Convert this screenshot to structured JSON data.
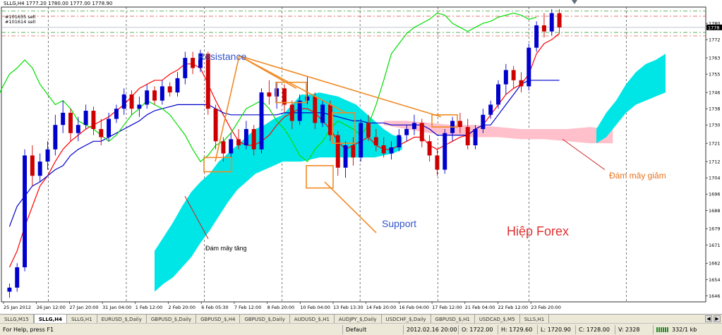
{
  "chart_info": {
    "header": "SLLG,H4  1777.20 1780.00 1777.00 1778.90",
    "level_labels": [
      "#101655 sell",
      "#101614 sell"
    ]
  },
  "price_axis": {
    "ticks": [
      "1780",
      "1772",
      "1763",
      "1755",
      "1746",
      "1738",
      "1730",
      "1721",
      "1712",
      "1704",
      "1696",
      "1688",
      "1679",
      "1671",
      "1662",
      "1654",
      "1646"
    ],
    "current_price": "1778"
  },
  "time_axis": {
    "ticks": [
      "25 Jan 2012",
      "26 Jan 12:00",
      "27 Jan 20:00",
      "31 Jan 04:00",
      "1 Feb 12:00",
      "2 Feb 20:00",
      "6 Feb 05:30",
      "7 Feb 12:00",
      "8 Feb 20:00",
      "10 Feb 04:00",
      "13 Feb 13:30",
      "14 Feb 20:00",
      "16 Feb 04:00",
      "17 Feb 12:00",
      "21 Feb 04:00",
      "22 Feb 12:00",
      "23 Feb 20:00"
    ]
  },
  "annotations": {
    "resistance": "Resistance",
    "support": "Support",
    "cloud_down": "Đám mây giảm",
    "cloud_up": "Đám mây tăng",
    "watermark": "Hiệp Forex"
  },
  "colors": {
    "candle_up": "#0000cc",
    "candle_down": "#cc0000",
    "tenkan": "#ff0000",
    "kijun": "#0000cc",
    "chikou": "#00dd00",
    "kumo_bull": "#00e6e6",
    "kumo_bear": "#ffc0cb",
    "annotation_box": "#f08a24",
    "resistance_text": "#3355cc",
    "cloud_text": "#e8701c",
    "watermark_text": "#e03030"
  },
  "tabs": [
    {
      "label": "SLLG,M15",
      "active": false
    },
    {
      "label": "SLLG,H4",
      "active": true
    },
    {
      "label": "SLLG,H1",
      "active": false
    },
    {
      "label": "EURUSD_$,Daily",
      "active": false
    },
    {
      "label": "GBPUSD_$,Daily",
      "active": false
    },
    {
      "label": "GBPUSD_$,H4",
      "active": false
    },
    {
      "label": "GBPUSD_$,Daily",
      "active": false
    },
    {
      "label": "AUDUSD_$,H1",
      "active": false
    },
    {
      "label": "AUDJPY_$,Daily",
      "active": false
    },
    {
      "label": "USDCHF_$,Daily",
      "active": false
    },
    {
      "label": "GBPUSD_$,H1",
      "active": false
    },
    {
      "label": "USDCAD_$,M5",
      "active": false
    },
    {
      "label": "SLLS,H1",
      "active": false
    }
  ],
  "status_bar": {
    "help": "For Help, press F1",
    "profile": "Default",
    "datetime": "2012.02.16 20:00",
    "open": "O: 1722.00",
    "high": "H: 1729.60",
    "low": "L: 1720.90",
    "close": "C: 1728.00",
    "volume": "V: 2328",
    "traffic": "332/1 kb"
  },
  "chart_data": {
    "type": "candlestick",
    "symbol": "SLLG",
    "timeframe": "H4",
    "ylim": [
      1643,
      1788
    ],
    "indicator": "Ichimoku Kinko Hyo",
    "sell_levels": [
      1783.5,
      1775.5,
      1773.8,
      1786.0
    ],
    "candles": [
      {
        "o": 1648,
        "h": 1652,
        "l": 1645,
        "c": 1650
      },
      {
        "o": 1650,
        "h": 1662,
        "l": 1648,
        "c": 1660
      },
      {
        "o": 1660,
        "h": 1718,
        "l": 1658,
        "c": 1715
      },
      {
        "o": 1715,
        "h": 1720,
        "l": 1700,
        "c": 1705
      },
      {
        "o": 1705,
        "h": 1716,
        "l": 1702,
        "c": 1712
      },
      {
        "o": 1712,
        "h": 1722,
        "l": 1708,
        "c": 1718
      },
      {
        "o": 1718,
        "h": 1735,
        "l": 1715,
        "c": 1730
      },
      {
        "o": 1730,
        "h": 1742,
        "l": 1726,
        "c": 1736
      },
      {
        "o": 1736,
        "h": 1738,
        "l": 1722,
        "c": 1726
      },
      {
        "o": 1726,
        "h": 1734,
        "l": 1722,
        "c": 1730
      },
      {
        "o": 1730,
        "h": 1740,
        "l": 1728,
        "c": 1737
      },
      {
        "o": 1737,
        "h": 1739,
        "l": 1725,
        "c": 1728
      },
      {
        "o": 1728,
        "h": 1733,
        "l": 1720,
        "c": 1724
      },
      {
        "o": 1724,
        "h": 1736,
        "l": 1722,
        "c": 1733
      },
      {
        "o": 1733,
        "h": 1740,
        "l": 1731,
        "c": 1738
      },
      {
        "o": 1738,
        "h": 1748,
        "l": 1735,
        "c": 1745
      },
      {
        "o": 1745,
        "h": 1747,
        "l": 1735,
        "c": 1738
      },
      {
        "o": 1738,
        "h": 1744,
        "l": 1734,
        "c": 1740
      },
      {
        "o": 1740,
        "h": 1750,
        "l": 1738,
        "c": 1747
      },
      {
        "o": 1747,
        "h": 1749,
        "l": 1740,
        "c": 1742
      },
      {
        "o": 1742,
        "h": 1752,
        "l": 1740,
        "c": 1749
      },
      {
        "o": 1749,
        "h": 1751,
        "l": 1744,
        "c": 1746
      },
      {
        "o": 1746,
        "h": 1756,
        "l": 1744,
        "c": 1753
      },
      {
        "o": 1753,
        "h": 1766,
        "l": 1750,
        "c": 1763
      },
      {
        "o": 1763,
        "h": 1766,
        "l": 1755,
        "c": 1758
      },
      {
        "o": 1758,
        "h": 1767,
        "l": 1756,
        "c": 1765
      },
      {
        "o": 1765,
        "h": 1766,
        "l": 1735,
        "c": 1738
      },
      {
        "o": 1738,
        "h": 1740,
        "l": 1718,
        "c": 1722
      },
      {
        "o": 1722,
        "h": 1724,
        "l": 1712,
        "c": 1716
      },
      {
        "o": 1716,
        "h": 1726,
        "l": 1714,
        "c": 1723
      },
      {
        "o": 1723,
        "h": 1728,
        "l": 1718,
        "c": 1720
      },
      {
        "o": 1720,
        "h": 1732,
        "l": 1718,
        "c": 1728
      },
      {
        "o": 1728,
        "h": 1730,
        "l": 1715,
        "c": 1718
      },
      {
        "o": 1718,
        "h": 1748,
        "l": 1716,
        "c": 1746
      },
      {
        "o": 1746,
        "h": 1752,
        "l": 1740,
        "c": 1744
      },
      {
        "o": 1744,
        "h": 1751,
        "l": 1738,
        "c": 1748
      },
      {
        "o": 1748,
        "h": 1750,
        "l": 1736,
        "c": 1740
      },
      {
        "o": 1740,
        "h": 1742,
        "l": 1728,
        "c": 1732
      },
      {
        "o": 1732,
        "h": 1745,
        "l": 1730,
        "c": 1742
      },
      {
        "o": 1742,
        "h": 1754,
        "l": 1740,
        "c": 1744
      },
      {
        "o": 1744,
        "h": 1746,
        "l": 1728,
        "c": 1731
      },
      {
        "o": 1731,
        "h": 1742,
        "l": 1729,
        "c": 1740
      },
      {
        "o": 1740,
        "h": 1742,
        "l": 1722,
        "c": 1725
      },
      {
        "o": 1725,
        "h": 1727,
        "l": 1705,
        "c": 1709
      },
      {
        "o": 1709,
        "h": 1722,
        "l": 1704,
        "c": 1720
      },
      {
        "o": 1720,
        "h": 1724,
        "l": 1710,
        "c": 1714
      },
      {
        "o": 1714,
        "h": 1733,
        "l": 1712,
        "c": 1731
      },
      {
        "o": 1731,
        "h": 1735,
        "l": 1722,
        "c": 1724
      },
      {
        "o": 1724,
        "h": 1728,
        "l": 1717,
        "c": 1720
      },
      {
        "o": 1720,
        "h": 1724,
        "l": 1714,
        "c": 1716
      },
      {
        "o": 1716,
        "h": 1722,
        "l": 1713,
        "c": 1719
      },
      {
        "o": 1719,
        "h": 1728,
        "l": 1717,
        "c": 1725
      },
      {
        "o": 1725,
        "h": 1730,
        "l": 1722,
        "c": 1728
      },
      {
        "o": 1728,
        "h": 1735,
        "l": 1725,
        "c": 1731
      },
      {
        "o": 1731,
        "h": 1733,
        "l": 1719,
        "c": 1722
      },
      {
        "o": 1722,
        "h": 1725,
        "l": 1712,
        "c": 1715
      },
      {
        "o": 1715,
        "h": 1718,
        "l": 1705,
        "c": 1708
      },
      {
        "o": 1708,
        "h": 1728,
        "l": 1706,
        "c": 1726
      },
      {
        "o": 1726,
        "h": 1734,
        "l": 1722,
        "c": 1732
      },
      {
        "o": 1732,
        "h": 1736,
        "l": 1726,
        "c": 1729
      },
      {
        "o": 1729,
        "h": 1733,
        "l": 1718,
        "c": 1720
      },
      {
        "o": 1720,
        "h": 1730,
        "l": 1718,
        "c": 1728
      },
      {
        "o": 1728,
        "h": 1738,
        "l": 1726,
        "c": 1735
      },
      {
        "o": 1735,
        "h": 1742,
        "l": 1733,
        "c": 1740
      },
      {
        "o": 1740,
        "h": 1752,
        "l": 1738,
        "c": 1750
      },
      {
        "o": 1750,
        "h": 1760,
        "l": 1745,
        "c": 1757
      },
      {
        "o": 1757,
        "h": 1759,
        "l": 1748,
        "c": 1752
      },
      {
        "o": 1752,
        "h": 1756,
        "l": 1746,
        "c": 1749
      },
      {
        "o": 1749,
        "h": 1770,
        "l": 1747,
        "c": 1768
      },
      {
        "o": 1768,
        "h": 1781,
        "l": 1766,
        "c": 1779
      },
      {
        "o": 1779,
        "h": 1785,
        "l": 1773,
        "c": 1776
      },
      {
        "o": 1776,
        "h": 1787,
        "l": 1774,
        "c": 1785
      },
      {
        "o": 1785,
        "h": 1787,
        "l": 1775,
        "c": 1778
      }
    ],
    "series": [
      {
        "name": "tenkan",
        "values": [
          1660,
          1668,
          1680,
          1690,
          1700,
          1705,
          1712,
          1718,
          1722,
          1725,
          1728,
          1730,
          1732,
          1734,
          1737,
          1740,
          1744,
          1748,
          1750,
          1752,
          1752,
          1755,
          1757,
          1760,
          1760,
          1758,
          1750,
          1742,
          1735,
          1728,
          1722,
          1720,
          1720,
          1722,
          1725,
          1730,
          1734,
          1736,
          1738,
          1738,
          1736,
          1732,
          1728,
          1722,
          1718,
          1720,
          1722,
          1724,
          1720,
          1718,
          1718,
          1720,
          1722,
          1724,
          1724,
          1720,
          1718,
          1720,
          1722,
          1724,
          1725,
          1728,
          1730,
          1735,
          1740,
          1745,
          1748,
          1750,
          1755,
          1765,
          1770,
          1772,
          1775
        ]
      },
      {
        "name": "kijun",
        "values": [
          1680,
          1690,
          1695,
          1700,
          1702,
          1705,
          1708,
          1710,
          1715,
          1718,
          1720,
          1722,
          1722,
          1724,
          1726,
          1728,
          1730,
          1732,
          1735,
          1737,
          1738,
          1739,
          1740,
          1740,
          1740,
          1740,
          1740,
          1738,
          1736,
          1735,
          1735,
          1735,
          1735,
          1735,
          1735,
          1735,
          1736,
          1736,
          1736,
          1736,
          1736,
          1736,
          1735,
          1734,
          1733,
          1732,
          1732,
          1731,
          1731,
          1731,
          1730,
          1730,
          1730,
          1730,
          1730,
          1728,
          1725,
          1725,
          1725,
          1725,
          1725,
          1728,
          1730,
          1730,
          1735,
          1740,
          1745,
          1750,
          1752,
          1752,
          1752,
          1752,
          1752
        ]
      },
      {
        "name": "chikou",
        "values": [
          1735,
          1740,
          1748,
          1755,
          1758,
          1762,
          1758,
          1750,
          1745,
          1740,
          1742,
          1738,
          1732,
          1730,
          1728,
          1725,
          1722,
          1725,
          1730,
          1735,
          1738,
          1742,
          1740,
          1738,
          1735,
          1730,
          1725,
          1718,
          1712,
          1715,
          1720,
          1722,
          1726,
          1732,
          1738,
          1740,
          1742,
          1738,
          1732,
          1728,
          1722,
          1715,
          1712,
          1718,
          1722,
          1728,
          1732,
          1730,
          1728,
          1725,
          1730,
          1740,
          1752,
          1765,
          1770,
          1775,
          1778,
          1780,
          1782,
          1785,
          1784,
          1780,
          1778,
          1776,
          1778,
          1780,
          1781,
          1783,
          1784,
          1785,
          1784,
          1782,
          1783
        ]
      }
    ]
  }
}
